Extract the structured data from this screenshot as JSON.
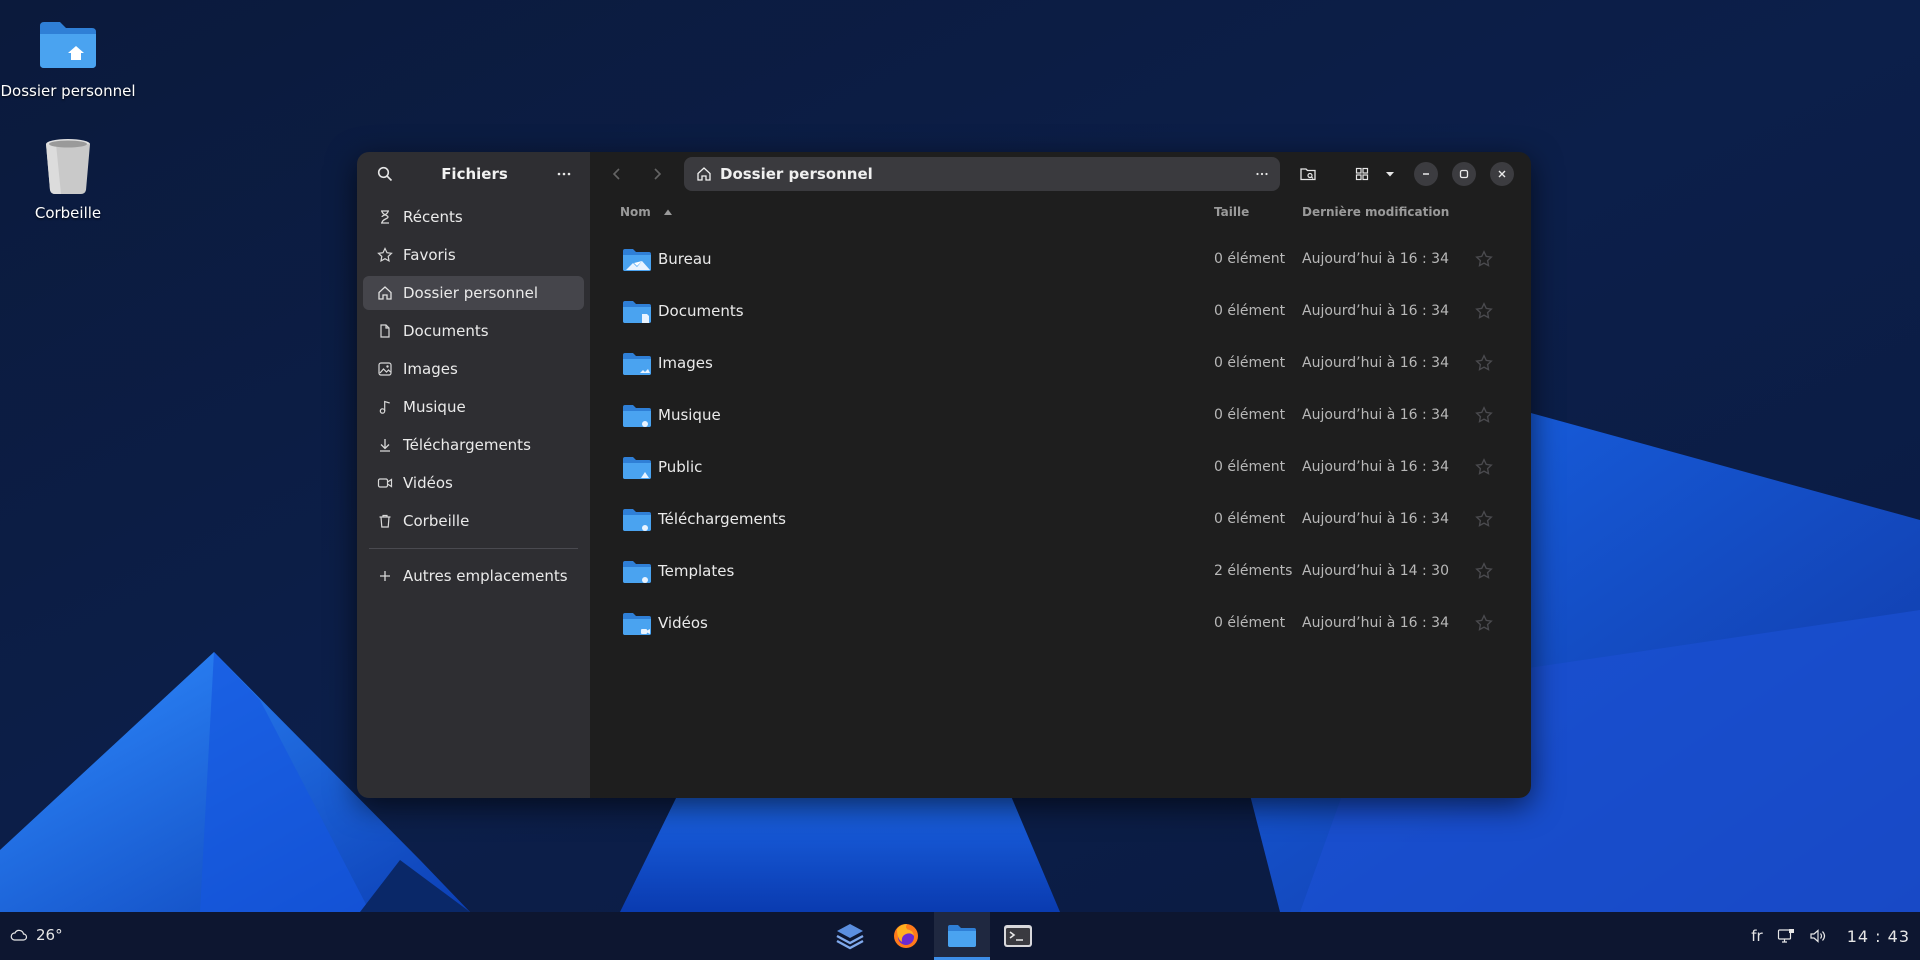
{
  "desktop": {
    "icons": [
      {
        "label": "Dossier personnel",
        "icon": "home-folder-icon"
      },
      {
        "label": "Corbeille",
        "icon": "trash-icon"
      }
    ]
  },
  "window": {
    "sidebar": {
      "title": "Fichiers",
      "items": [
        {
          "label": "Récents",
          "icon": "hourglass-icon"
        },
        {
          "label": "Favoris",
          "icon": "star-icon"
        },
        {
          "label": "Dossier personnel",
          "icon": "home-icon",
          "active": true
        },
        {
          "label": "Documents",
          "icon": "document-icon"
        },
        {
          "label": "Images",
          "icon": "image-icon"
        },
        {
          "label": "Musique",
          "icon": "music-icon"
        },
        {
          "label": "Téléchargements",
          "icon": "download-icon"
        },
        {
          "label": "Vidéos",
          "icon": "video-icon"
        },
        {
          "label": "Corbeille",
          "icon": "trash-icon"
        }
      ],
      "other_locations": "Autres emplacements"
    },
    "path": "Dossier personnel",
    "columns": {
      "name": "Nom",
      "size": "Taille",
      "modified": "Dernière modification"
    },
    "files": [
      {
        "name": "Bureau",
        "size": "0 élément",
        "modified": "Aujourd’hui à 16 : 34"
      },
      {
        "name": "Documents",
        "size": "0 élément",
        "modified": "Aujourd’hui à 16 : 34"
      },
      {
        "name": "Images",
        "size": "0 élément",
        "modified": "Aujourd’hui à 16 : 34"
      },
      {
        "name": "Musique",
        "size": "0 élément",
        "modified": "Aujourd’hui à 16 : 34"
      },
      {
        "name": "Public",
        "size": "0 élément",
        "modified": "Aujourd’hui à 16 : 34"
      },
      {
        "name": "Téléchargements",
        "size": "0 élément",
        "modified": "Aujourd’hui à 16 : 34"
      },
      {
        "name": "Templates",
        "size": "2 éléments",
        "modified": "Aujourd’hui à 14 : 30"
      },
      {
        "name": "Vidéos",
        "size": "0 élément",
        "modified": "Aujourd’hui à 16 : 34"
      }
    ]
  },
  "taskbar": {
    "weather": "26°",
    "apps": [
      "layers-icon",
      "firefox-icon",
      "files-icon",
      "terminal-icon"
    ],
    "active_app": "files-icon",
    "language": "fr",
    "clock": "14 : 43"
  },
  "colors": {
    "accent": "#3d8ee8",
    "folder": "#4aa3f0",
    "sidebar_bg": "#2e2e32",
    "main_bg": "#1e1e1e"
  }
}
